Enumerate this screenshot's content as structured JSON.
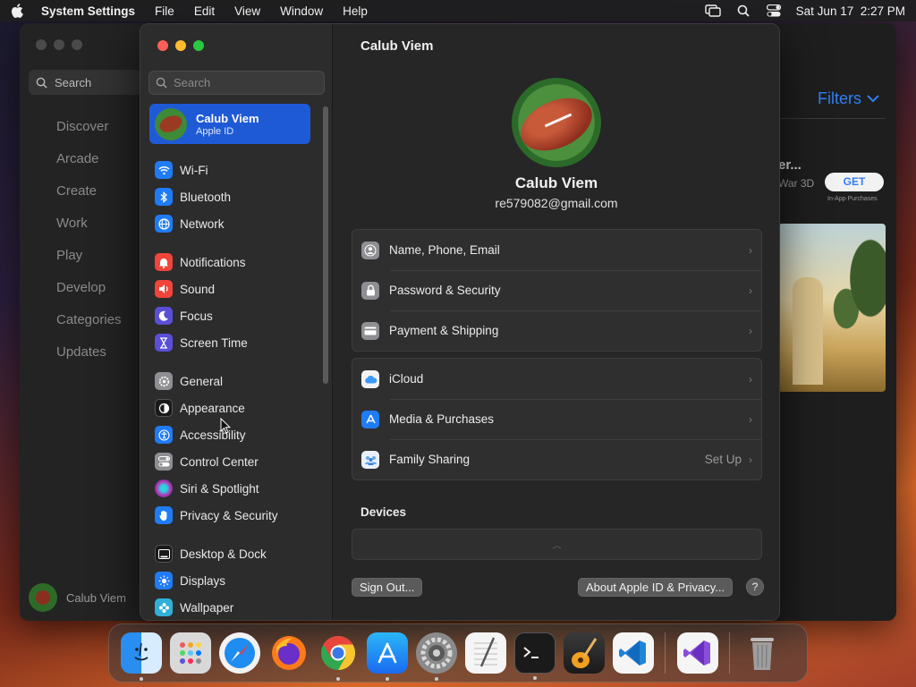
{
  "menubar": {
    "app_name": "System Settings",
    "menus": [
      "File",
      "Edit",
      "View",
      "Window",
      "Help"
    ],
    "datetime": "Sat Jun 17  2:27 PM"
  },
  "background_window": {
    "search_label": "Search",
    "nav": [
      "Discover",
      "Arcade",
      "Create",
      "Work",
      "Play",
      "Develop",
      "Categories",
      "Updates"
    ],
    "user_name": "Calub Viem",
    "filters_label": "Filters",
    "game_title": "er...",
    "game_subtitle": "War 3D",
    "get_label": "GET",
    "in_app_label": "In-App Purchases"
  },
  "sidebar": {
    "search_placeholder": "Search",
    "account": {
      "name": "Calub Viem",
      "subtitle": "Apple ID"
    },
    "groups": [
      [
        {
          "label": "Wi-Fi",
          "icon": "wifi-icon",
          "color": "#1f7cf5"
        },
        {
          "label": "Bluetooth",
          "icon": "bluetooth-icon",
          "color": "#1f7cf5"
        },
        {
          "label": "Network",
          "icon": "globe-icon",
          "color": "#1f7cf5"
        }
      ],
      [
        {
          "label": "Notifications",
          "icon": "bell-icon",
          "color": "#f0453a"
        },
        {
          "label": "Sound",
          "icon": "speaker-icon",
          "color": "#f0453a"
        },
        {
          "label": "Focus",
          "icon": "moon-icon",
          "color": "#5a4fd6"
        },
        {
          "label": "Screen Time",
          "icon": "hourglass-icon",
          "color": "#5a4fd6"
        }
      ],
      [
        {
          "label": "General",
          "icon": "gear-icon",
          "color": "#8e8e93"
        },
        {
          "label": "Appearance",
          "icon": "appearance-icon",
          "color": "#1a1a1a"
        },
        {
          "label": "Accessibility",
          "icon": "accessibility-icon",
          "color": "#1f7cf5"
        },
        {
          "label": "Control Center",
          "icon": "control-center-icon",
          "color": "#8e8e93"
        },
        {
          "label": "Siri & Spotlight",
          "icon": "siri-icon",
          "color": "#b03ab8"
        },
        {
          "label": "Privacy & Security",
          "icon": "hand-icon",
          "color": "#1f7cf5"
        }
      ],
      [
        {
          "label": "Desktop & Dock",
          "icon": "dock-icon",
          "color": "#1a1a1a"
        },
        {
          "label": "Displays",
          "icon": "sun-icon",
          "color": "#1f7cf5"
        },
        {
          "label": "Wallpaper",
          "icon": "flower-icon",
          "color": "#2fb0d8"
        }
      ]
    ]
  },
  "content": {
    "title": "Calub Viem",
    "profile_name": "Calub Viem",
    "email": "re579082@gmail.com",
    "card1": [
      {
        "label": "Name, Phone, Email",
        "icon": "person-icon",
        "color": "#8e8e93"
      },
      {
        "label": "Password & Security",
        "icon": "lock-icon",
        "color": "#8e8e93"
      },
      {
        "label": "Payment & Shipping",
        "icon": "card-icon",
        "color": "#8e8e93"
      }
    ],
    "card2": [
      {
        "label": "iCloud",
        "icon": "cloud-icon",
        "color": "#f2f2f2",
        "value": ""
      },
      {
        "label": "Media & Purchases",
        "icon": "app-store-icon",
        "color": "#1f7cf5",
        "value": ""
      },
      {
        "label": "Family Sharing",
        "icon": "family-icon",
        "color": "#e8f0fa",
        "value": "Set Up"
      }
    ],
    "devices_title": "Devices",
    "sign_out": "Sign Out...",
    "about": "About Apple ID & Privacy...",
    "help": "?"
  },
  "dock": [
    {
      "name": "finder",
      "running": true
    },
    {
      "name": "launchpad",
      "running": false
    },
    {
      "name": "safari",
      "running": false
    },
    {
      "name": "firefox",
      "running": false
    },
    {
      "name": "chrome",
      "running": true
    },
    {
      "name": "app-store",
      "running": true
    },
    {
      "name": "system-settings",
      "running": true
    },
    {
      "name": "textedit",
      "running": false
    },
    {
      "name": "terminal",
      "running": true
    },
    {
      "name": "garageband",
      "running": false
    },
    {
      "name": "vscode",
      "running": false
    },
    {
      "name": "visual-studio",
      "running": false
    },
    {
      "name": "trash",
      "running": false
    }
  ]
}
